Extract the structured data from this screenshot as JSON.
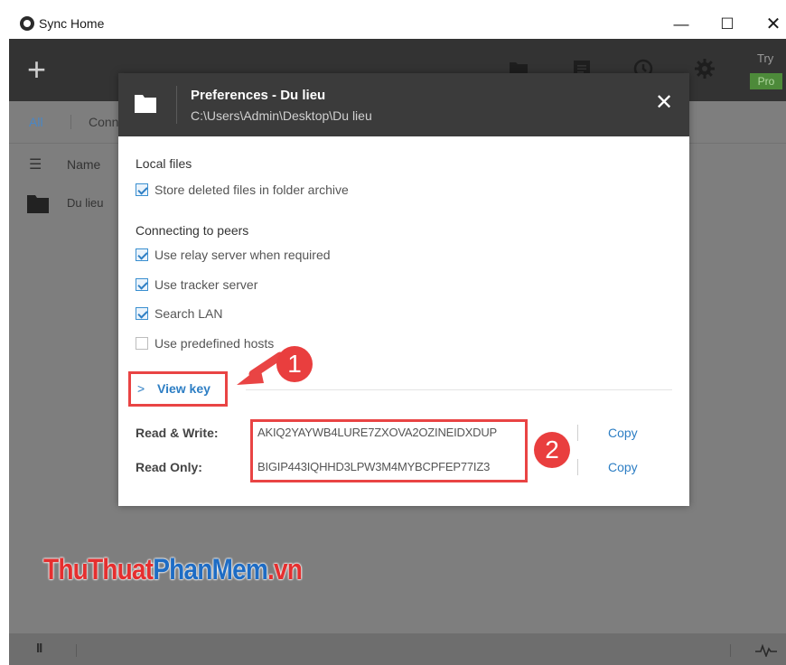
{
  "window": {
    "title": "Sync Home",
    "minimize": "—",
    "maximize": "☐",
    "close": "✕"
  },
  "toolbar": {
    "add": "+",
    "icons": [
      "folder-icon",
      "list-icon",
      "clock-icon",
      "gear-icon"
    ],
    "try_label": "Try",
    "pro_label": "Pro"
  },
  "tabs": {
    "all": "All",
    "connected": "Conn"
  },
  "list": {
    "column_name": "Name",
    "rows": [
      {
        "name": "Du lieu"
      }
    ]
  },
  "dialog": {
    "title": "Preferences - Du lieu",
    "path": "C:\\Users\\Admin\\Desktop\\Du lieu",
    "close": "✕",
    "local_files": {
      "heading": "Local files",
      "options": [
        {
          "label": "Store deleted files in folder archive",
          "checked": true
        }
      ]
    },
    "peers": {
      "heading": "Connecting to peers",
      "options": [
        {
          "label": "Use relay server when required",
          "checked": true
        },
        {
          "label": "Use tracker server",
          "checked": true
        },
        {
          "label": "Search LAN",
          "checked": true
        },
        {
          "label": "Use predefined hosts",
          "checked": false
        }
      ]
    },
    "view_key": {
      "chevron": ">",
      "label": "View key"
    },
    "keys": {
      "read_write": {
        "label": "Read & Write:",
        "value": "AKIQ2YAYWB4LURE7ZXOVA2OZINEIDXDUP",
        "copy": "Copy"
      },
      "read_only": {
        "label": "Read Only:",
        "value": "BIGIP443IQHHD3LPW3M4MYBCPFEP77IZ3",
        "copy": "Copy"
      }
    }
  },
  "status": {
    "pause": "II"
  },
  "annotations": {
    "marker_1": "1",
    "marker_2": "2",
    "color": "#e94444"
  },
  "watermark": {
    "part1": "ThuThuat",
    "part2": "PhanMem",
    "part3": ".vn"
  },
  "colors": {
    "accent": "#2d7ec4",
    "dialog_header": "#3b3b3b",
    "pro_badge": "#4d8a3a",
    "highlight": "#e94444"
  }
}
